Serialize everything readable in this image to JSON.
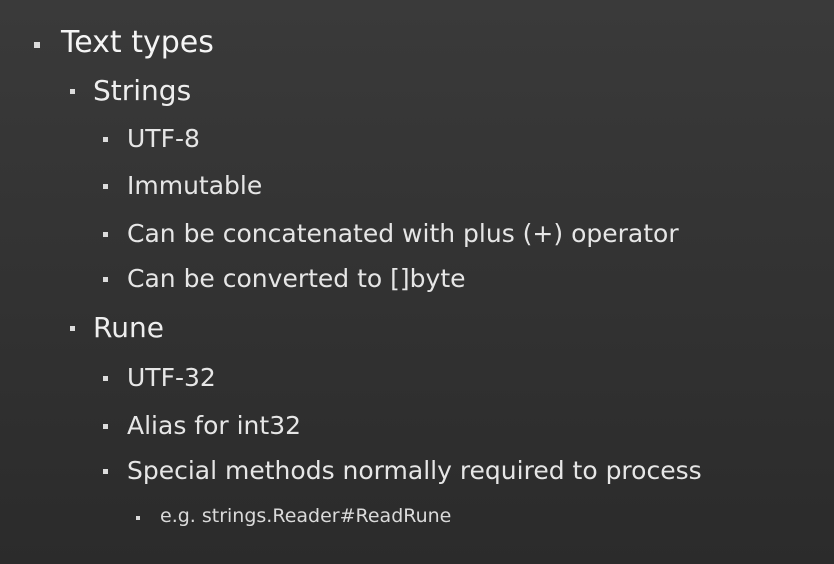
{
  "slide": {
    "bullets": [
      {
        "level": 1,
        "text": "Text types"
      },
      {
        "level": 2,
        "text": "Strings"
      },
      {
        "level": 3,
        "text": "UTF-8"
      },
      {
        "level": 3,
        "text": "Immutable"
      },
      {
        "level": 3,
        "text": "Can be concatenated with plus (+) operator"
      },
      {
        "level": 3,
        "text": "Can be converted to []byte"
      },
      {
        "level": 2,
        "text": "Rune"
      },
      {
        "level": 3,
        "text": "UTF-32"
      },
      {
        "level": 3,
        "text": "Alias for int32"
      },
      {
        "level": 3,
        "text": "Special methods normally required to process"
      },
      {
        "level": 4,
        "text": "e.g. strings.Reader#ReadRune"
      }
    ]
  }
}
